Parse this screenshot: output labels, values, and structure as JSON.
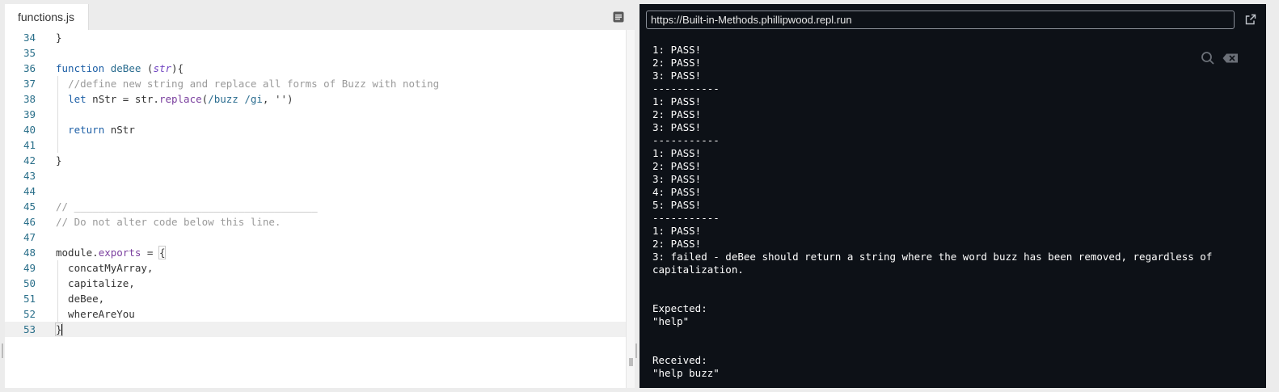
{
  "editor": {
    "tab_label": "functions.js",
    "current_line": "53",
    "lines": [
      {
        "n": "34",
        "t": "}"
      },
      {
        "n": "35",
        "t": ""
      },
      {
        "n": "36",
        "t": "function deBee (str){"
      },
      {
        "n": "37",
        "t": "  //define new string and replace all forms of Buzz with noting"
      },
      {
        "n": "38",
        "t": "  let nStr = str.replace(/buzz /gi, '')"
      },
      {
        "n": "39",
        "t": ""
      },
      {
        "n": "40",
        "t": "  return nStr"
      },
      {
        "n": "41",
        "t": ""
      },
      {
        "n": "42",
        "t": "}"
      },
      {
        "n": "43",
        "t": ""
      },
      {
        "n": "44",
        "t": ""
      },
      {
        "n": "45",
        "t": "// ________________________________________"
      },
      {
        "n": "46",
        "t": "// Do not alter code below this line."
      },
      {
        "n": "47",
        "t": ""
      },
      {
        "n": "48",
        "t": "module.exports = {"
      },
      {
        "n": "49",
        "t": "  concatMyArray,"
      },
      {
        "n": "50",
        "t": "  capitalize,"
      },
      {
        "n": "51",
        "t": "  deBee,"
      },
      {
        "n": "52",
        "t": "  whereAreYou"
      },
      {
        "n": "53",
        "t": "}"
      }
    ]
  },
  "console": {
    "url": "https://Built-in-Methods.phillipwood.repl.run",
    "output": [
      "1: PASS!",
      "2: PASS!",
      "3: PASS!",
      "-----------",
      "1: PASS!",
      "2: PASS!",
      "3: PASS!",
      "-----------",
      "1: PASS!",
      "2: PASS!",
      "3: PASS!",
      "4: PASS!",
      "5: PASS!",
      "-----------",
      "1: PASS!",
      "2: PASS!",
      "3: failed - deBee should return a string where the word buzz has been removed, regardless of",
      "capitalization.",
      "",
      "",
      "Expected:",
      "\"help\"",
      "",
      "",
      "Received:",
      "\"help buzz\""
    ]
  },
  "icons": {
    "panel_toggle": "panel-toggle-icon",
    "open_in_new": "open-in-new-tab-icon",
    "search": "search-icon",
    "clear": "clear-console-icon"
  },
  "colors": {
    "console_bg": "#0d1117",
    "editor_bg": "#ffffff",
    "keyword": "#1d5fa6",
    "comment": "#9a9a9a",
    "line_number": "#2a6f8a"
  }
}
